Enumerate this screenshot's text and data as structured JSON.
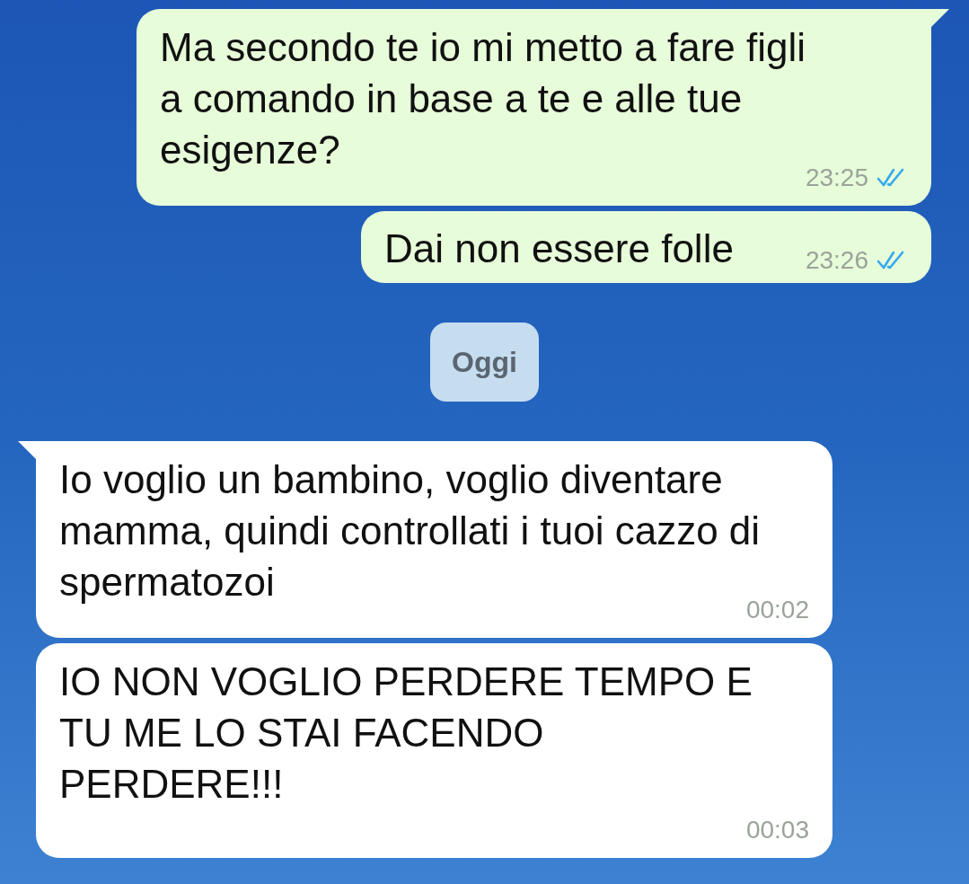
{
  "messages": [
    {
      "kind": "outgoing",
      "text": "Ma secondo te io mi metto a fare figli a comando in base a te e alle tue esigenze?",
      "time": "23:25",
      "read": true,
      "tail": true
    },
    {
      "kind": "outgoing",
      "text": "Dai non essere folle",
      "time": "23:26",
      "read": true,
      "tail": false
    },
    {
      "kind": "date",
      "text": "Oggi"
    },
    {
      "kind": "incoming",
      "text": "Io voglio un bambino, voglio diventare mamma, quindi controllati i tuoi cazzo di spermatozoi",
      "time": "00:02",
      "tail": true
    },
    {
      "kind": "incoming",
      "text": "IO NON VOGLIO PERDERE TEMPO E TU ME LO STAI FACENDO PERDERE!!!",
      "time": "00:03",
      "tail": false
    }
  ]
}
